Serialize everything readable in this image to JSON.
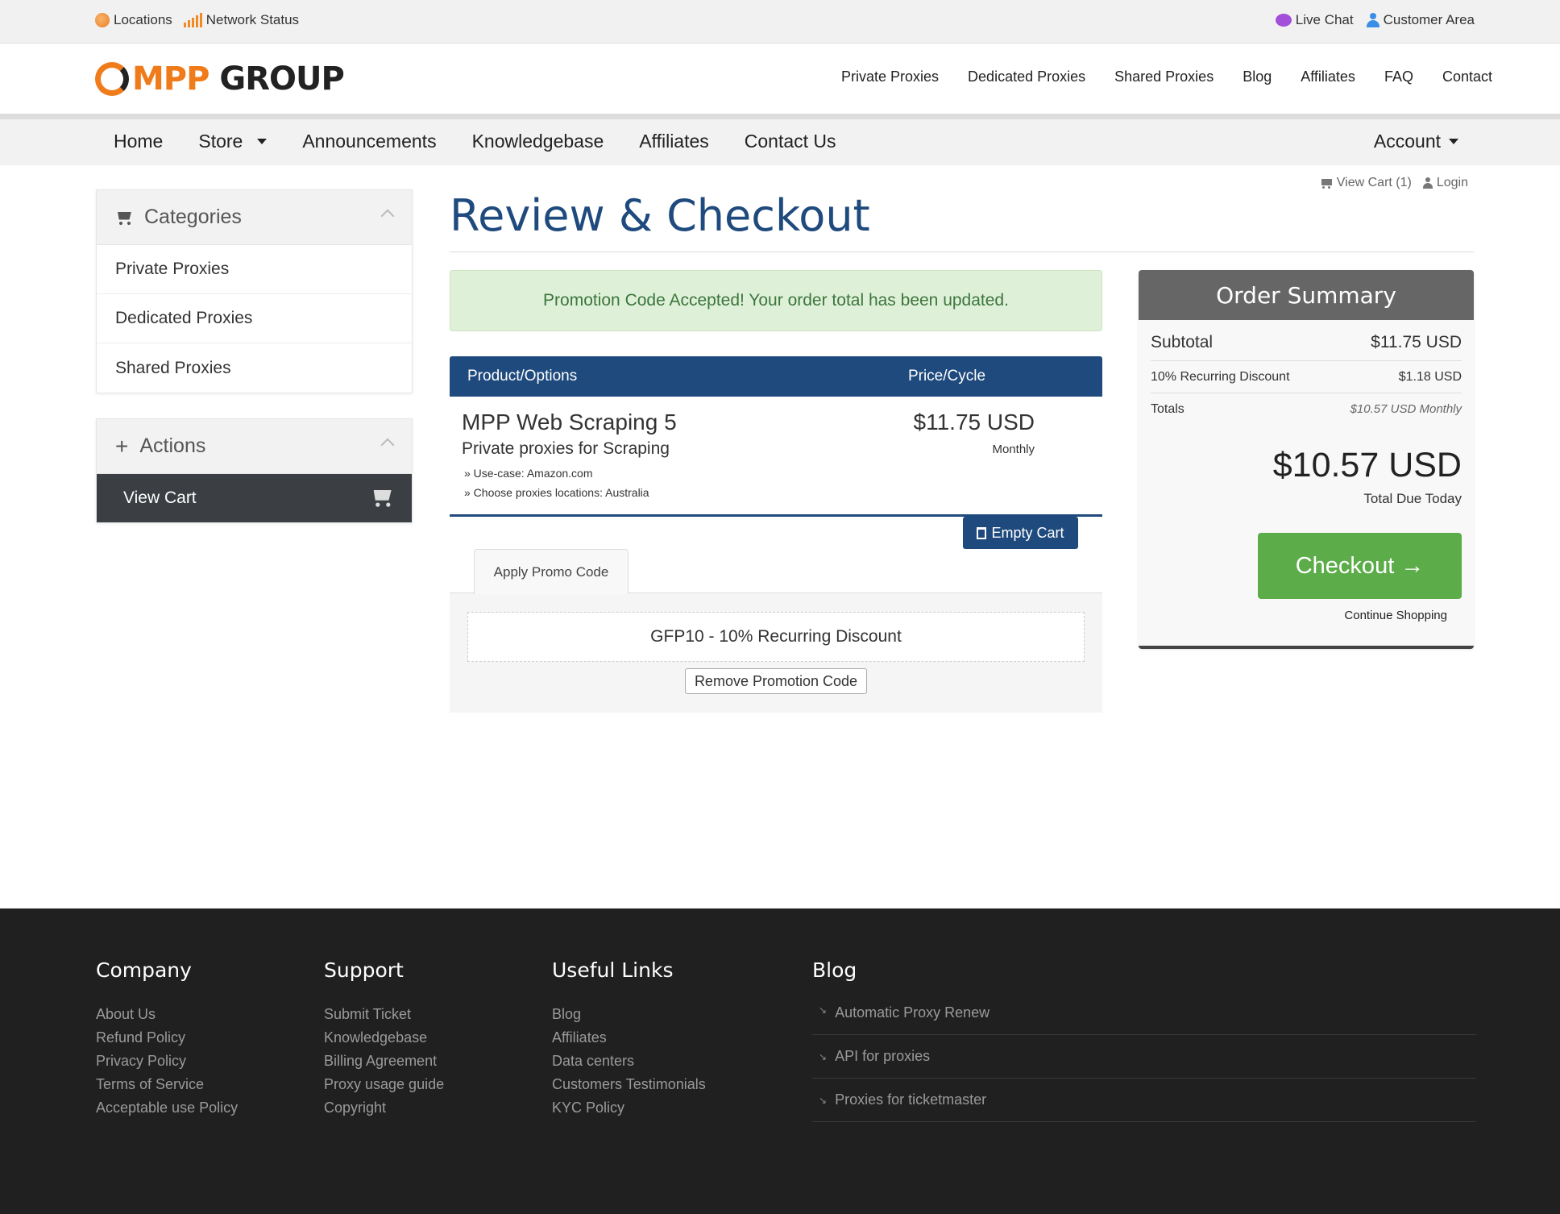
{
  "utility": {
    "left": [
      {
        "label": "Locations",
        "icon": "globe-icon"
      },
      {
        "label": "Network Status",
        "icon": "signal-bars-icon"
      }
    ],
    "right": [
      {
        "label": "Live Chat",
        "icon": "chat-bubble-icon"
      },
      {
        "label": "Customer Area",
        "icon": "user-icon"
      }
    ]
  },
  "brand": {
    "logo_part1": "MPP",
    "logo_part2": "GROUP"
  },
  "topnav": [
    "Private Proxies",
    "Dedicated Proxies",
    "Shared Proxies",
    "Blog",
    "Affiliates",
    "FAQ",
    "Contact"
  ],
  "mainnav": {
    "items": [
      "Home",
      "Store",
      "Announcements",
      "Knowledgebase",
      "Affiliates",
      "Contact Us"
    ],
    "account": "Account"
  },
  "sidebar": {
    "categories_title": "Categories",
    "categories": [
      "Private Proxies",
      "Dedicated Proxies",
      "Shared Proxies"
    ],
    "actions_title": "Actions",
    "view_cart": "View Cart"
  },
  "toplinks": {
    "view_cart": "View Cart (1)",
    "login": "Login"
  },
  "page": {
    "title": "Review & Checkout"
  },
  "alert": {
    "text": "Promotion Code Accepted! Your order total has been updated."
  },
  "cart": {
    "headers": {
      "product": "Product/Options",
      "price": "Price/Cycle"
    },
    "item": {
      "name": "MPP Web Scraping 5",
      "group": "Private proxies for Scraping",
      "options": [
        "» Use-case: Amazon.com",
        "» Choose proxies locations: Australia"
      ],
      "price": "$11.75 USD",
      "cycle": "Monthly"
    },
    "empty_cart": "Empty Cart"
  },
  "promo": {
    "tab_label": "Apply Promo Code",
    "applied_code": "GFP10 - 10% Recurring Discount",
    "remove_label": "Remove Promotion Code"
  },
  "summary": {
    "title": "Order Summary",
    "subtotal_label": "Subtotal",
    "subtotal_value": "$11.75 USD",
    "discount_label": "10% Recurring Discount",
    "discount_value": "$1.18 USD",
    "totals_label": "Totals",
    "totals_value": "$10.57 USD Monthly",
    "total_due": "$10.57 USD",
    "total_due_label": "Total Due Today",
    "checkout": "Checkout",
    "continue": "Continue Shopping"
  },
  "footer": {
    "company": {
      "title": "Company",
      "links": [
        "About Us",
        "Refund Policy",
        "Privacy Policy",
        "Terms of Service",
        "Acceptable use Policy"
      ]
    },
    "support": {
      "title": "Support",
      "links": [
        "Submit Ticket",
        "Knowledgebase",
        "Billing Agreement",
        "Proxy usage guide",
        "Copyright"
      ]
    },
    "useful": {
      "title": "Useful Links",
      "links": [
        "Blog",
        "Affiliates",
        "Data centers",
        "Customers Testimonials",
        "KYC Policy"
      ]
    },
    "blog": {
      "title": "Blog",
      "links": [
        "Automatic Proxy Renew",
        "API for proxies",
        "Proxies for ticketmaster"
      ]
    }
  },
  "colors": {
    "brand_orange": "#f07b1a",
    "primary_blue": "#1f4a7d",
    "checkout_green": "#5cad4a",
    "footer_bg": "#202020"
  }
}
